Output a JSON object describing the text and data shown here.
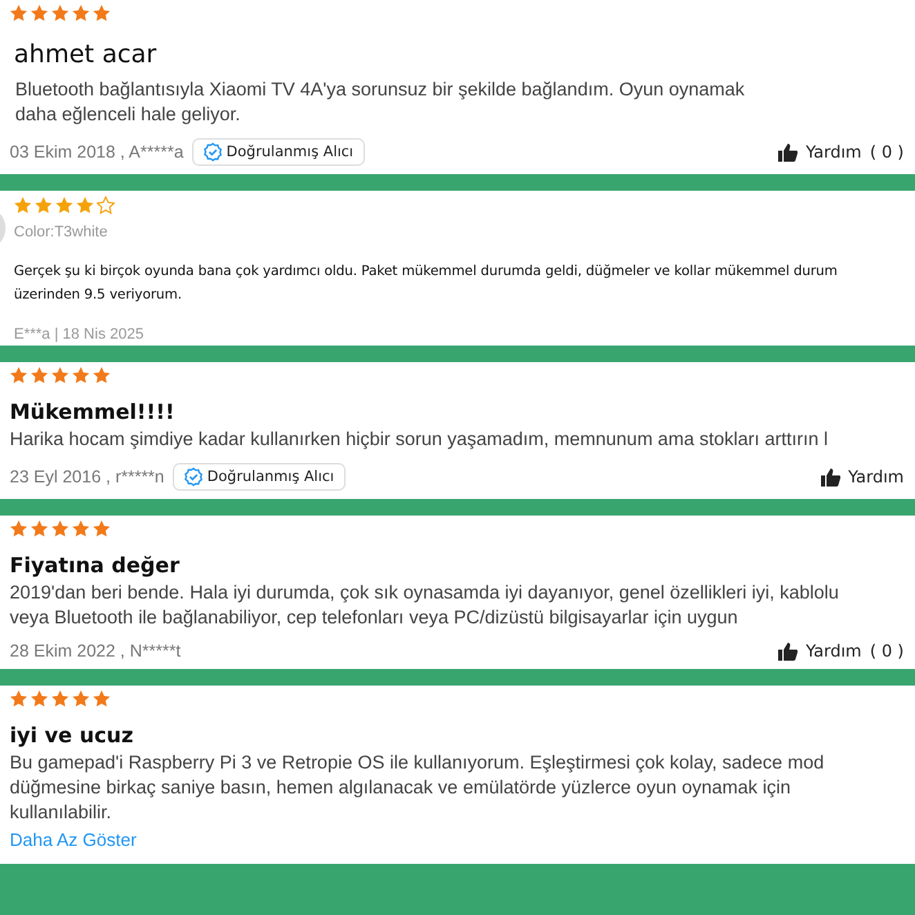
{
  "reviews": [
    {
      "kind": "store",
      "stars": 5,
      "title": "ahmet acar",
      "body": "Bluetooth bağlantısıyla Xiaomi TV 4A'ya sorunsuz bir şekilde bağlandım. Oyun oynamak daha eğlenceli hale geliyor.",
      "meta": "03 Ekim 2018 , A*****a",
      "badge": "Doğrulanmış Alıcı",
      "helpful": {
        "label": "Yardım",
        "count": "( 0 )"
      }
    },
    {
      "kind": "market",
      "stars": 4,
      "variant": "Color:T3white",
      "body": "Gerçek şu ki birçok oyunda bana çok yardımcı oldu. Paket mükemmel durumda geldi, düğmeler ve kollar mükemmel durum",
      "body_more": "üzerinden 9.5 veriyorum.",
      "meta": "E***a | 18 Nis 2025"
    },
    {
      "kind": "store",
      "stars": 5,
      "title": "Mükemmel!!!!",
      "body": "Harika hocam şimdiye kadar kullanırken hiçbir sorun yaşamadım, memnunum ama stokları arttırın l",
      "meta": "23 Eyl 2016 , r*****n",
      "badge": "Doğrulanmış Alıcı",
      "helpful": {
        "label": "Yardım"
      }
    },
    {
      "kind": "store",
      "stars": 5,
      "title": "Fiyatına değer",
      "body": "2019'dan beri bende. Hala iyi durumda, çok sık oynasamda iyi dayanıyor, genel özellikleri iyi, kablolu veya Bluetooth ile bağlanabiliyor, cep telefonları veya PC/dizüstü bilgisayarlar için uygun",
      "meta": "28 Ekim 2022 , N*****t",
      "helpful": {
        "label": "Yardım",
        "count": "( 0 )"
      }
    },
    {
      "kind": "store",
      "stars": 5,
      "title": "iyi ve ucuz",
      "body": "Bu gamepad'i Raspberry Pi 3 ve Retropie OS ile kullanıyorum. Eşleştirmesi çok kolay, sadece mod düğmesine birkaç saniye basın, hemen algılanacak ve emülatörde yüzlerce oyun oynamak için kullanılabilir.",
      "link": "Daha Az Göster"
    }
  ]
}
